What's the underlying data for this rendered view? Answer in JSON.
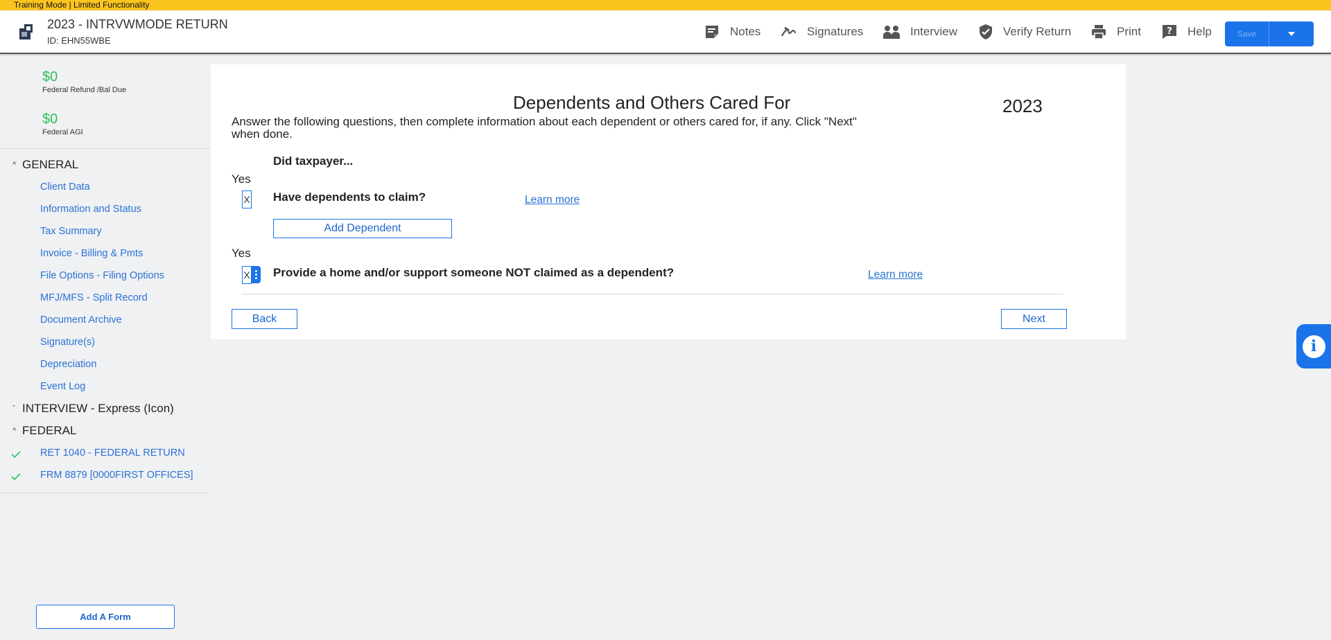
{
  "banner": {
    "text": "Training Mode | Limited Functionality"
  },
  "header": {
    "title": "2023 - INTRVWMODE RETURN",
    "id_text": "ID: EHN55WBE",
    "nav": [
      {
        "label": "Notes",
        "icon": "notes-icon"
      },
      {
        "label": "Signatures",
        "icon": "signature-icon"
      },
      {
        "label": "Interview",
        "icon": "interview-icon"
      },
      {
        "label": "Verify Return",
        "icon": "shield-check-icon"
      },
      {
        "label": "Print",
        "icon": "printer-icon"
      },
      {
        "label": "Help",
        "icon": "help-icon"
      }
    ],
    "save_label": "Save"
  },
  "sidebar": {
    "refund": {
      "amount": "$0",
      "label": "Federal Refund /Bal Due"
    },
    "agi": {
      "amount": "$0",
      "label": "Federal AGI"
    },
    "sections": [
      {
        "label": "GENERAL",
        "expanded": true
      },
      {
        "label": "INTERVIEW - Express (Icon)",
        "expanded": false
      },
      {
        "label": "FEDERAL",
        "expanded": true
      }
    ],
    "general_items": [
      "Client Data",
      "Information and Status",
      "Tax Summary",
      "Invoice - Billing & Pmts",
      "File Options - Filing Options",
      "MFJ/MFS - Split Record",
      "Document Archive",
      "Signature(s)",
      "Depreciation",
      "Event Log"
    ],
    "federal_items": [
      "RET 1040 - FEDERAL RETURN",
      "FRM 8879 [0000FIRST OFFICES]"
    ],
    "add_form_label": "Add A Form"
  },
  "form": {
    "title": "Dependents and Others Cared For",
    "year": "2023",
    "instructions": "Answer the following questions, then complete information about each dependent or others cared for, if any. Click \"Next\" when done.",
    "question_heading": "Did taxpayer...",
    "q1": {
      "yes_label": "Yes",
      "checkbox_value": "X",
      "text": "Have dependents to claim?",
      "learn_more": "Learn more"
    },
    "add_dependent_label": "Add Dependent",
    "q2": {
      "yes_label": "Yes",
      "checkbox_value": "X",
      "text": "Provide a home and/or support someone NOT claimed as a dependent?",
      "learn_more": "Learn more"
    },
    "back_label": "Back",
    "next_label": "Next"
  },
  "info_fab": {
    "glyph": "i"
  },
  "colors": {
    "accent": "#1a73e8",
    "banner": "#fbc520",
    "money": "#2ec05a",
    "link": "#2a72d5"
  }
}
